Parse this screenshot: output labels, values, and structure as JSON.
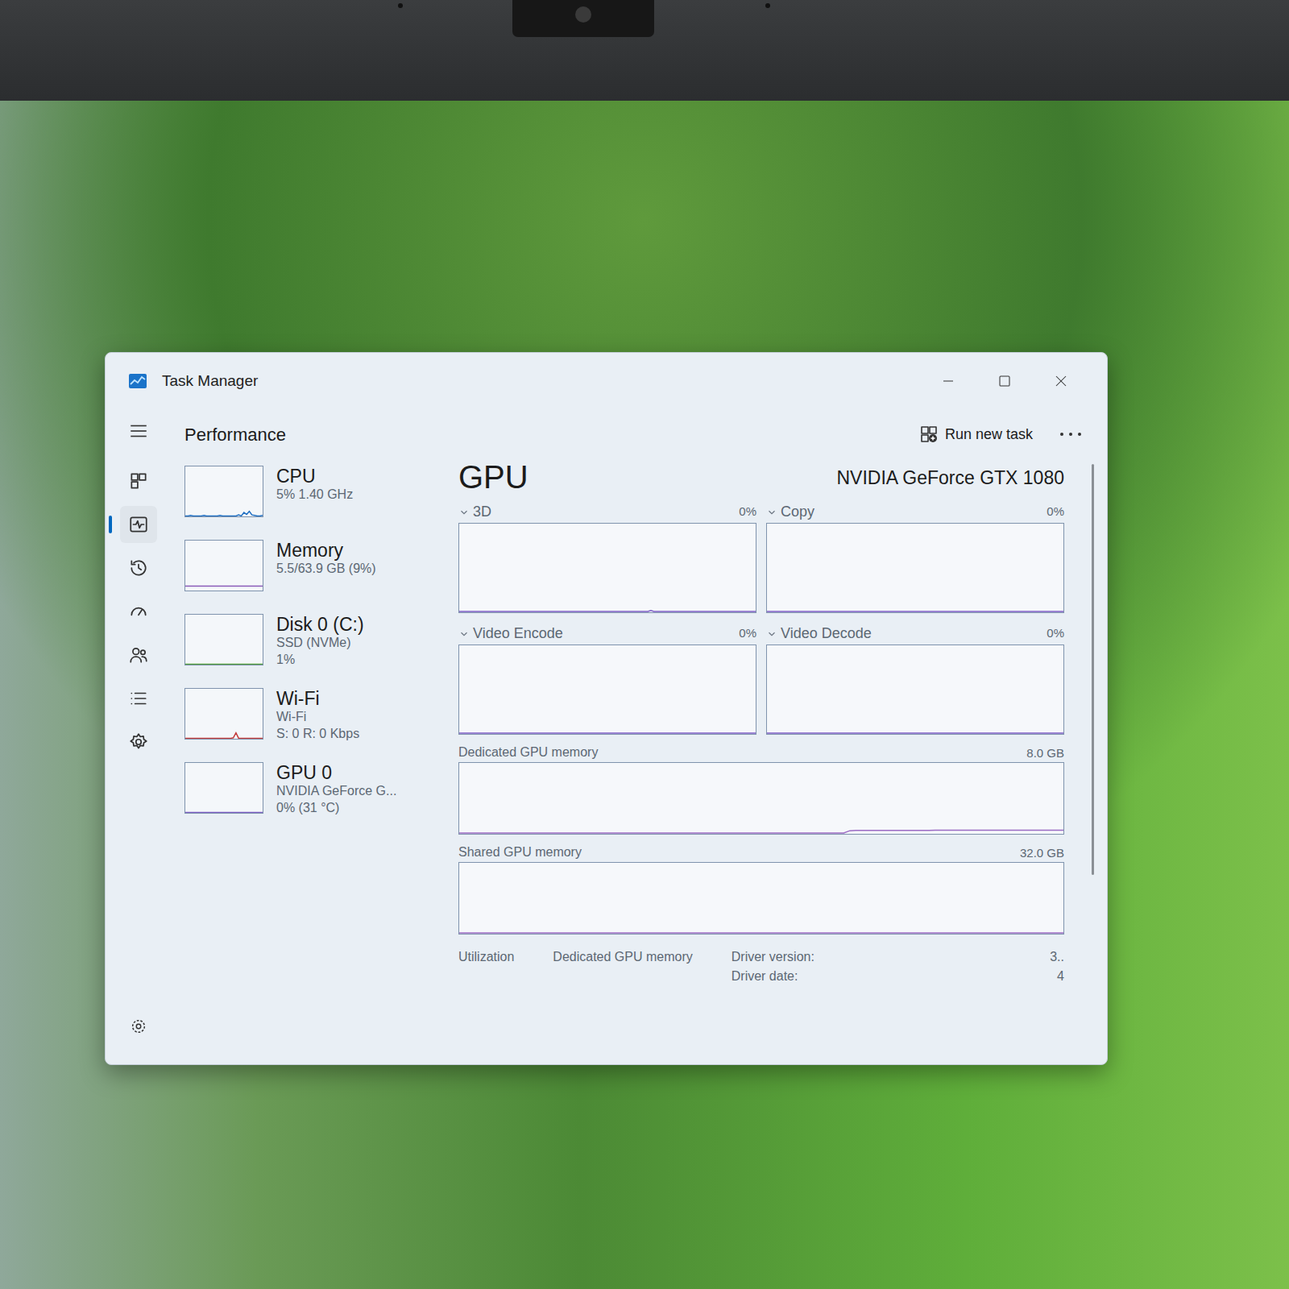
{
  "window": {
    "title": "Task Manager"
  },
  "header": {
    "title": "Performance",
    "run_task": "Run new task"
  },
  "nav": {
    "items": [
      {
        "selected": false
      },
      {
        "selected": true
      },
      {
        "selected": false
      },
      {
        "selected": false
      },
      {
        "selected": false
      },
      {
        "selected": false
      },
      {
        "selected": false
      }
    ]
  },
  "devices": [
    {
      "name": "CPU",
      "lines": [
        "5% 1.40 GHz"
      ],
      "color": "#1f6fc2",
      "values": [
        1,
        1,
        2,
        1,
        1,
        1,
        1,
        2,
        1,
        1,
        1,
        1,
        1,
        2,
        1,
        1,
        1,
        1,
        1,
        1,
        3,
        1,
        8,
        4,
        10,
        3,
        2,
        1,
        1,
        2
      ]
    },
    {
      "name": "Memory",
      "lines": [
        "5.5/63.9 GB (9%)"
      ],
      "color": "#8a5cb8",
      "values": [
        9,
        9,
        9,
        9,
        9,
        9,
        9,
        9,
        9,
        9,
        9,
        9,
        9,
        9,
        9,
        9,
        9,
        9,
        9,
        9,
        9,
        9,
        9,
        9,
        9,
        9,
        9,
        9,
        9,
        9
      ]
    },
    {
      "name": "Disk 0 (C:)",
      "lines": [
        "SSD (NVMe)",
        "1%"
      ],
      "color": "#4f9c3a",
      "values": [
        0,
        0,
        0,
        0,
        1,
        0,
        0,
        0,
        0,
        0,
        0,
        0,
        0,
        0,
        1,
        0,
        0,
        0,
        0,
        0,
        0,
        0,
        0,
        0,
        1,
        0,
        0,
        0,
        0,
        1
      ]
    },
    {
      "name": "Wi-Fi",
      "lines": [
        "Wi-Fi",
        "S: 0 R: 0 Kbps"
      ],
      "color": "#c23a3a",
      "values": [
        0,
        0,
        0,
        0,
        0,
        0,
        0,
        0,
        0,
        0,
        0,
        0,
        0,
        0,
        0,
        0,
        0,
        0,
        2,
        12,
        0,
        0,
        0,
        0,
        0,
        0,
        0,
        0,
        0,
        0
      ]
    },
    {
      "name": "GPU 0",
      "lines": [
        "NVIDIA GeForce G...",
        "0% (31 °C)"
      ],
      "color": "#7b5cc4",
      "values": [
        0,
        0,
        0,
        0,
        0,
        0,
        0,
        0,
        0,
        0,
        0,
        0,
        0,
        0,
        0,
        0,
        0,
        0,
        0,
        0,
        0,
        0,
        0,
        0,
        0,
        0,
        0,
        0,
        0,
        0
      ]
    }
  ],
  "detail": {
    "title": "GPU",
    "model": "NVIDIA GeForce GTX 1080",
    "engines": [
      {
        "label": "3D",
        "reading": "0%",
        "values": [
          0,
          0,
          0,
          0,
          0,
          0,
          0,
          0,
          0,
          0,
          0,
          0,
          0,
          0,
          0,
          0,
          0,
          0,
          0,
          0,
          0,
          0,
          0,
          0,
          0,
          0,
          0,
          0,
          0,
          0,
          0,
          0,
          0,
          0,
          0,
          0,
          0,
          0,
          0,
          0,
          0,
          0,
          0,
          0,
          0,
          0,
          0,
          0,
          0,
          0,
          0,
          0,
          0,
          0,
          0,
          0,
          0,
          0,
          0,
          0,
          0,
          0,
          0,
          0,
          2,
          0,
          0,
          0,
          0,
          0,
          1,
          0,
          0,
          0,
          0,
          0,
          0,
          0,
          0,
          0,
          0,
          0,
          0,
          0,
          0,
          0,
          0,
          0,
          0,
          0,
          0,
          0,
          0,
          0,
          0,
          0,
          0,
          0,
          0,
          0
        ]
      },
      {
        "label": "Copy",
        "reading": "0%",
        "values": [
          0,
          0,
          0,
          0,
          0,
          0,
          0,
          0,
          0,
          0,
          0,
          0,
          0,
          0,
          0,
          0,
          0,
          0,
          0,
          0,
          0,
          0,
          0,
          0,
          0,
          0,
          0,
          0,
          0,
          0,
          0,
          0,
          0,
          0,
          0,
          0,
          0,
          0,
          0,
          0,
          0,
          0,
          0,
          0,
          0,
          0,
          0,
          0,
          0,
          0,
          0,
          0,
          0,
          0,
          0,
          0,
          0,
          0,
          0,
          0,
          0,
          0,
          0,
          0,
          0,
          0,
          0,
          0,
          0,
          0,
          0,
          0,
          0,
          0,
          0,
          0,
          0,
          0,
          0,
          0,
          0,
          0,
          0,
          0,
          0,
          0,
          0,
          0,
          0,
          0,
          0,
          0,
          0,
          0,
          0,
          0,
          0,
          0,
          0,
          0
        ]
      },
      {
        "label": "Video Encode",
        "reading": "0%",
        "values": [
          0,
          0,
          0,
          0,
          0,
          0,
          0,
          0,
          0,
          0,
          0,
          0,
          0,
          0,
          0,
          0,
          0,
          0,
          0,
          0,
          0,
          0,
          0,
          0,
          0,
          0,
          0,
          0,
          0,
          0,
          0,
          0,
          0,
          0,
          0,
          0,
          0,
          0,
          0,
          0,
          0,
          0,
          0,
          0,
          0,
          0,
          0,
          0,
          0,
          0,
          0,
          0,
          0,
          0,
          0,
          0,
          0,
          0,
          0,
          0,
          0,
          0,
          0,
          0,
          0,
          0,
          0,
          0,
          0,
          0,
          0,
          0,
          0,
          0,
          0,
          0,
          0,
          0,
          0,
          0,
          0,
          0,
          0,
          0,
          0,
          0,
          0,
          0,
          0,
          0,
          0,
          0,
          0,
          0,
          0,
          0,
          0,
          0,
          0,
          0
        ]
      },
      {
        "label": "Video Decode",
        "reading": "0%",
        "values": [
          0,
          0,
          0,
          0,
          0,
          0,
          0,
          0,
          0,
          0,
          0,
          0,
          0,
          0,
          0,
          0,
          0,
          0,
          0,
          0,
          0,
          0,
          0,
          0,
          0,
          0,
          0,
          0,
          0,
          0,
          0,
          0,
          0,
          0,
          0,
          0,
          0,
          0,
          0,
          0,
          0,
          0,
          0,
          0,
          0,
          0,
          0,
          0,
          0,
          0,
          0,
          0,
          0,
          0,
          0,
          0,
          0,
          0,
          0,
          0,
          0,
          0,
          0,
          0,
          0,
          0,
          0,
          0,
          0,
          0,
          0,
          0,
          0,
          0,
          0,
          0,
          0,
          0,
          0,
          0,
          0,
          0,
          0,
          0,
          0,
          0,
          0,
          0,
          0,
          0,
          0,
          0,
          0,
          0,
          0,
          0,
          0,
          0,
          0,
          0
        ]
      }
    ],
    "memory": [
      {
        "label": "Dedicated GPU memory",
        "max": "8.0 GB",
        "values": [
          0,
          0,
          0,
          0,
          0,
          0,
          0,
          0,
          0,
          0,
          0,
          0,
          0,
          0,
          0,
          0,
          0,
          0,
          0,
          0,
          0,
          0,
          0,
          0,
          0,
          0,
          0,
          0,
          0,
          0,
          0,
          0,
          0,
          0,
          0,
          0,
          0,
          0,
          0,
          0,
          0,
          0,
          0,
          0,
          0,
          0,
          0,
          0,
          0,
          0,
          0,
          0,
          0,
          0,
          0,
          0,
          0,
          0,
          0,
          0,
          0,
          0,
          0,
          0.1,
          0.35,
          0.38,
          0.38,
          0.38,
          0.38,
          0.38,
          0.38,
          0.38,
          0.38,
          0.38,
          0.38,
          0.38,
          0.38,
          0.38,
          0.4,
          0.4,
          0.4,
          0.4,
          0.4,
          0.4,
          0.4,
          0.4,
          0.4,
          0.4,
          0.4,
          0.4,
          0.4,
          0.4,
          0.4,
          0.4,
          0.4,
          0.4,
          0.4,
          0.4,
          0.4,
          0.4
        ]
      },
      {
        "label": "Shared GPU memory",
        "max": "32.0 GB",
        "values": [
          0,
          0,
          0,
          0,
          0,
          0,
          0,
          0,
          0,
          0,
          0,
          0,
          0,
          0,
          0,
          0,
          0,
          0,
          0,
          0,
          0,
          0,
          0,
          0,
          0,
          0,
          0,
          0,
          0,
          0,
          0,
          0,
          0,
          0,
          0,
          0,
          0,
          0,
          0,
          0,
          0,
          0,
          0,
          0,
          0,
          0,
          0,
          0,
          0,
          0,
          0,
          0,
          0,
          0,
          0,
          0,
          0,
          0,
          0,
          0,
          0,
          0,
          0,
          0,
          0,
          0,
          0,
          0,
          0,
          0,
          0,
          0,
          0,
          0,
          0,
          0,
          0,
          0,
          0,
          0,
          0,
          0,
          0,
          0,
          0,
          0,
          0,
          0,
          0,
          0,
          0,
          0,
          0,
          0,
          0,
          0,
          0,
          0,
          0,
          0
        ]
      }
    ],
    "stats": [
      {
        "label": "Utilization"
      },
      {
        "label": "Dedicated GPU memory"
      }
    ],
    "info": [
      {
        "label": "Driver version:",
        "value": "3.."
      },
      {
        "label": "Driver date:",
        "value": "4"
      }
    ]
  }
}
